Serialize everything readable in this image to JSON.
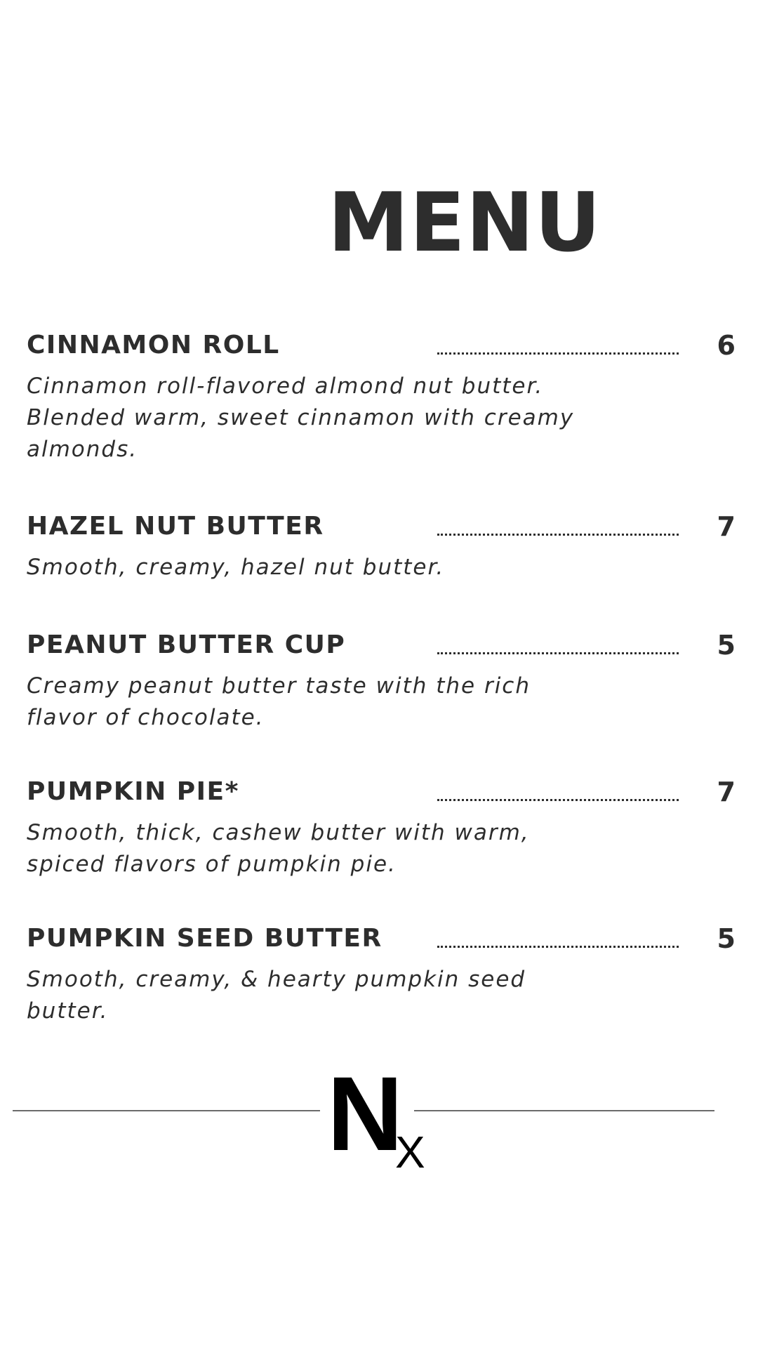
{
  "title": "MENU",
  "items": [
    {
      "name": "CINNAMON ROLL",
      "price": "6",
      "description": "Cinnamon roll-flavored almond nut butter. Blended warm, sweet cinnamon with creamy almonds."
    },
    {
      "name": "HAZEL NUT BUTTER",
      "price": "7",
      "description": "Smooth, creamy, hazel nut butter."
    },
    {
      "name": "PEANUT BUTTER CUP",
      "price": "5",
      "description": "Creamy peanut butter taste with the rich flavor of chocolate."
    },
    {
      "name": "PUMPKIN PIE*",
      "price": "7",
      "description": "Smooth, thick, cashew butter with warm, spiced flavors of pumpkin pie."
    },
    {
      "name": "PUMPKIN SEED BUTTER",
      "price": "5",
      "description": "Smooth, creamy, & hearty pumpkin seed butter."
    }
  ],
  "logo": {
    "big_letter": "N",
    "small_letter": "X"
  }
}
